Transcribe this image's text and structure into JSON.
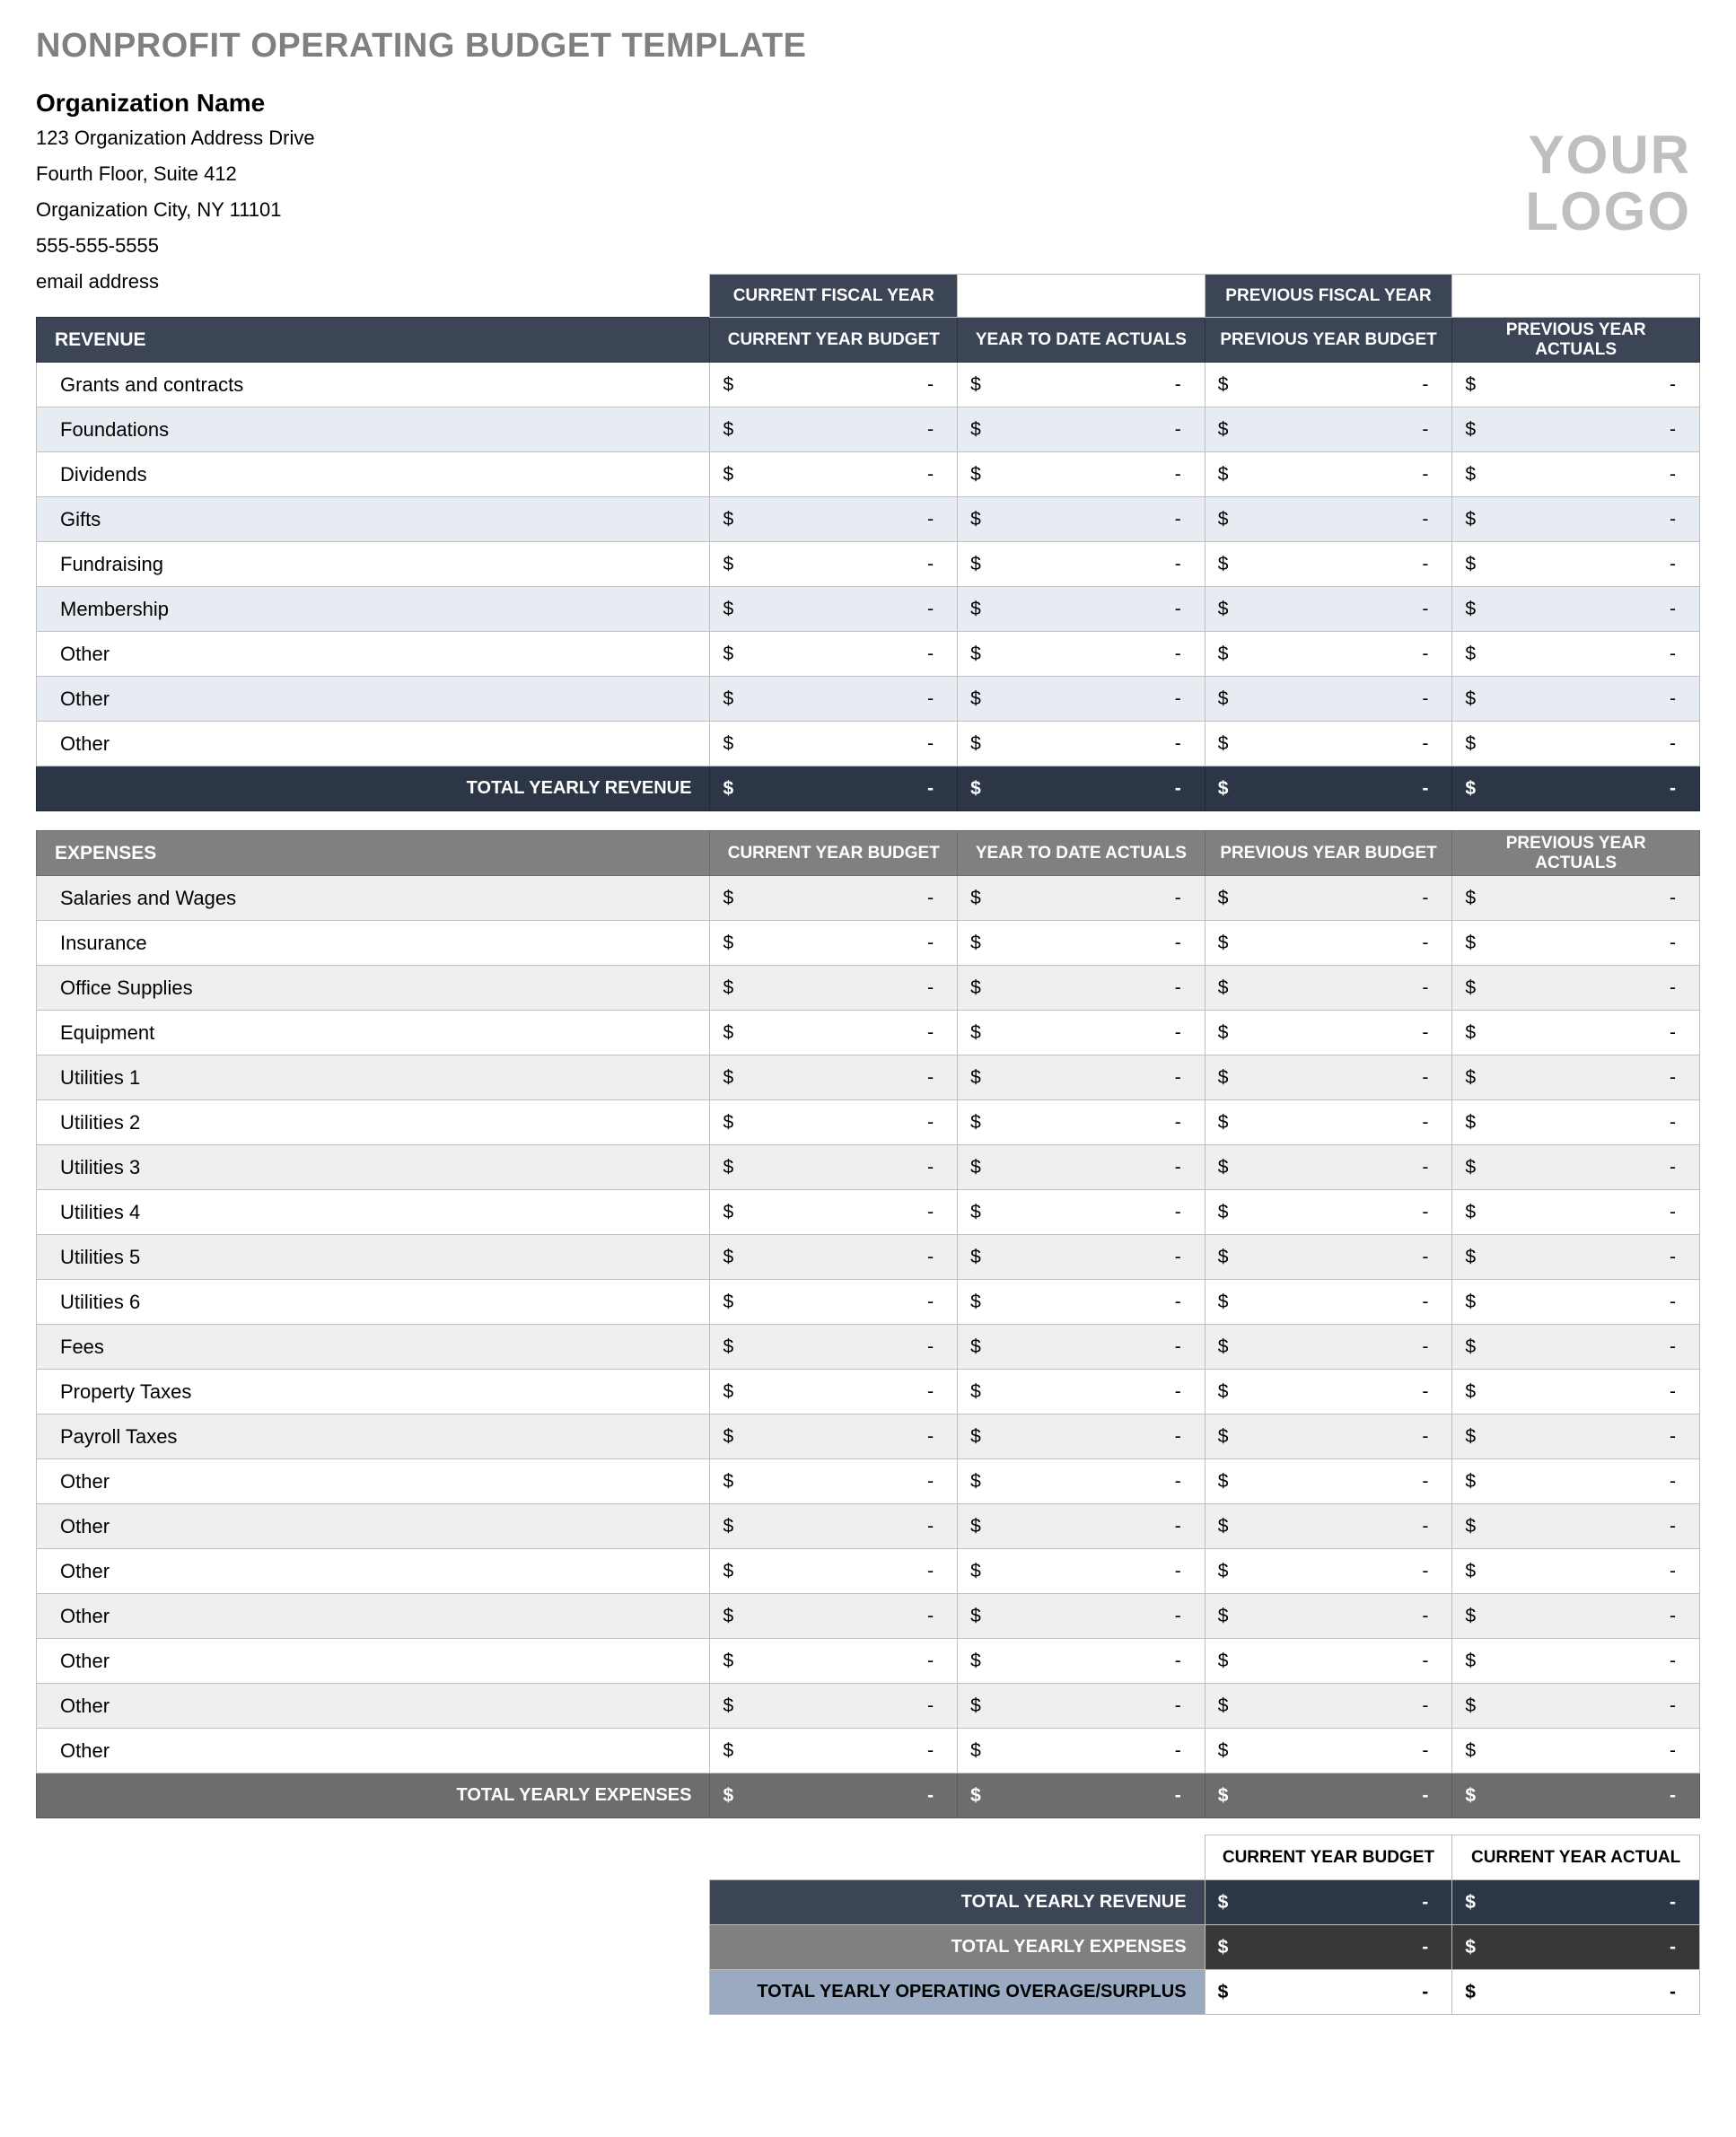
{
  "title": "NONPROFIT OPERATING BUDGET TEMPLATE",
  "org": {
    "name": "Organization Name",
    "addr1": "123 Organization Address Drive",
    "addr2": "Fourth Floor, Suite 412",
    "city": "Organization City, NY  11101",
    "phone": "555-555-5555",
    "email": "email address"
  },
  "logo": {
    "line1": "YOUR",
    "line2": "LOGO"
  },
  "fiscal": {
    "current_label": "CURRENT FISCAL YEAR",
    "current_value": "",
    "previous_label": "PREVIOUS FISCAL YEAR",
    "previous_value": ""
  },
  "columns": {
    "c1": "CURRENT YEAR BUDGET",
    "c2": "YEAR TO DATE ACTUALS",
    "c3": "PREVIOUS YEAR BUDGET",
    "c4": "PREVIOUS YEAR ACTUALS"
  },
  "revenue": {
    "header": "REVENUE",
    "rows": [
      "Grants and contracts",
      "Foundations",
      "Dividends",
      "Gifts",
      "Fundraising",
      "Membership",
      "Other",
      "Other",
      "Other"
    ],
    "total_label": "TOTAL YEARLY REVENUE"
  },
  "expenses": {
    "header": "EXPENSES",
    "rows": [
      "Salaries and Wages",
      "Insurance",
      "Office Supplies",
      "Equipment",
      "Utilities 1",
      "Utilities 2",
      "Utilities 3",
      "Utilities 4",
      "Utilities 5",
      "Utilities 6",
      "Fees",
      "Property Taxes",
      "Payroll Taxes",
      "Other",
      "Other",
      "Other",
      "Other",
      "Other",
      "Other",
      "Other"
    ],
    "total_label": "TOTAL YEARLY EXPENSES"
  },
  "summary": {
    "col1": "CURRENT YEAR BUDGET",
    "col2": "CURRENT YEAR ACTUAL",
    "rev": "TOTAL YEARLY REVENUE",
    "exp": "TOTAL YEARLY EXPENSES",
    "surplus": "TOTAL YEARLY OPERATING OVERAGE/SURPLUS"
  },
  "cell": {
    "dollar": "$",
    "dash": "-"
  }
}
